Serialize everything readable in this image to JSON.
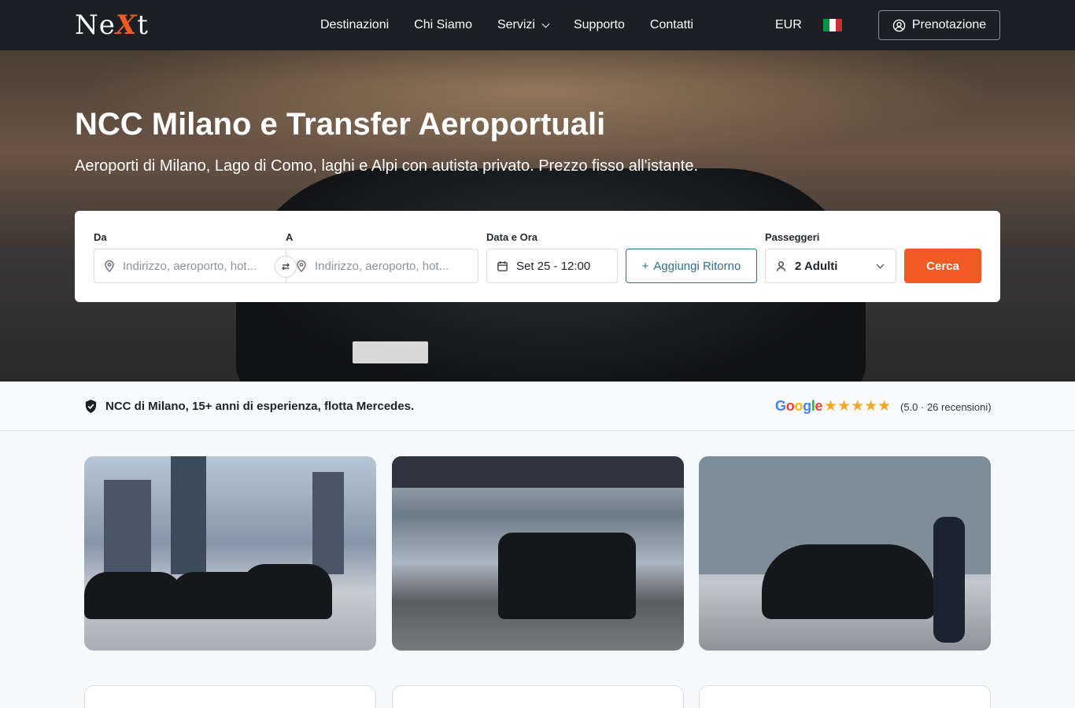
{
  "nav": {
    "logo": {
      "part1": "Ne",
      "part2": "X",
      "part3": "t"
    },
    "links": [
      "Destinazioni",
      "Chi Siamo",
      "Servizi",
      "Supporto",
      "Contatti"
    ],
    "currency": "EUR",
    "flag_colors": [
      "#009246",
      "#ffffff",
      "#ce2b37"
    ],
    "login_label": "Prenotazione"
  },
  "hero": {
    "title": "NCC Milano e Transfer Aeroportuali",
    "subtitle": "Aeroporti di Milano, Lago di Como, laghi e Alpi con autista privato. Prezzo fisso all'istante."
  },
  "search": {
    "from_label": "Da",
    "from_placeholder": "Indirizzo, aeroporto, hot...",
    "to_label": "A",
    "to_placeholder": "Indirizzo, aeroporto, hot...",
    "date_label": "Data e Ora",
    "date_value": "Set 25 - 12:00",
    "return_label": "Aggiungi Ritorno",
    "passengers_label": "Passeggeri",
    "passengers_value": "2 Adulti",
    "submit_label": "Cerca",
    "accent": "#f15a22"
  },
  "trust": {
    "text": "NCC di Milano, 15+ anni di esperienza, flotta Mercedes.",
    "google_letters": [
      "G",
      "o",
      "o",
      "g",
      "l",
      "e"
    ],
    "google_colors": [
      "#4285f4",
      "#ea4335",
      "#fbbc05",
      "#4285f4",
      "#34a853",
      "#ea4335"
    ],
    "stars": "★★★★★",
    "rating_text": "(5.0 · 26 recensioni)"
  }
}
